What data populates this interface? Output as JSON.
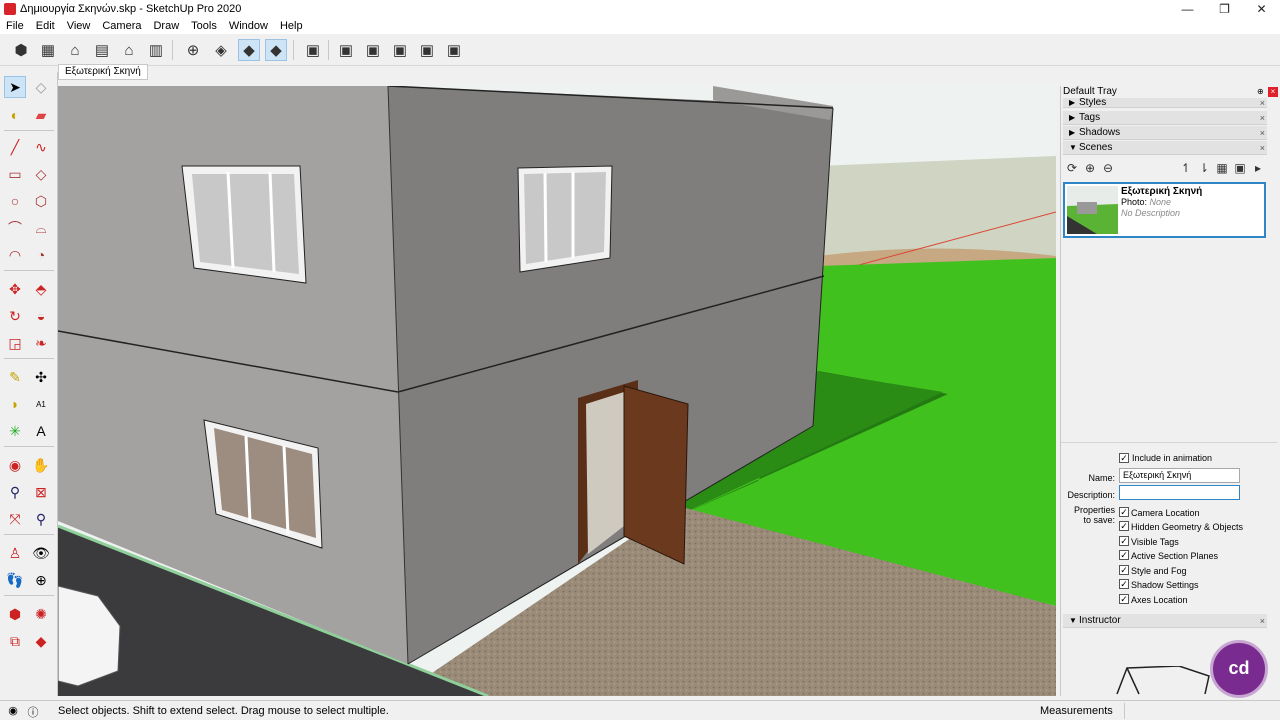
{
  "window": {
    "title": "Δημιουργία Σκηνών.skp - SketchUp Pro 2020",
    "minimize": "—",
    "maximize": "❐",
    "close": "✕"
  },
  "menu": [
    "File",
    "Edit",
    "View",
    "Camera",
    "Draw",
    "Tools",
    "Window",
    "Help"
  ],
  "scene_tab": "Εξωτερική Σκηνή",
  "tray": {
    "title": "Default Tray",
    "pin": "⊕",
    "close": "×",
    "panels": [
      {
        "label": "Styles",
        "state": "collapsed"
      },
      {
        "label": "Tags",
        "state": "collapsed"
      },
      {
        "label": "Shadows",
        "state": "collapsed"
      },
      {
        "label": "Scenes",
        "state": "expanded"
      }
    ],
    "scene": {
      "name": "Εξωτερική Σκηνή",
      "photo_label": "Photo:",
      "photo_value": "None",
      "description": "No Description"
    },
    "include_in_animation": "Include in animation",
    "name_label": "Name:",
    "name_value": "Εξωτερική Σκηνή",
    "description_label": "Description:",
    "description_value": "",
    "properties_label_1": "Properties",
    "properties_label_2": "to save:",
    "properties": [
      "Camera Location",
      "Hidden Geometry & Objects",
      "Visible Tags",
      "Active Section Planes",
      "Style and Fog",
      "Shadow Settings",
      "Axes Location"
    ],
    "instructor": "Instructor"
  },
  "status": {
    "message": "Select objects. Shift to extend select. Drag mouse to select multiple.",
    "measurements_label": "Measurements"
  },
  "logo_text": "cd",
  "colors": {
    "scene_border": "#2f86c6",
    "sky": "#eef2f1",
    "grass": "#3fbf1a",
    "wall_light": "#a3a2a1",
    "wall_dark": "#7d7c7b",
    "door": "#6b3a1e"
  }
}
